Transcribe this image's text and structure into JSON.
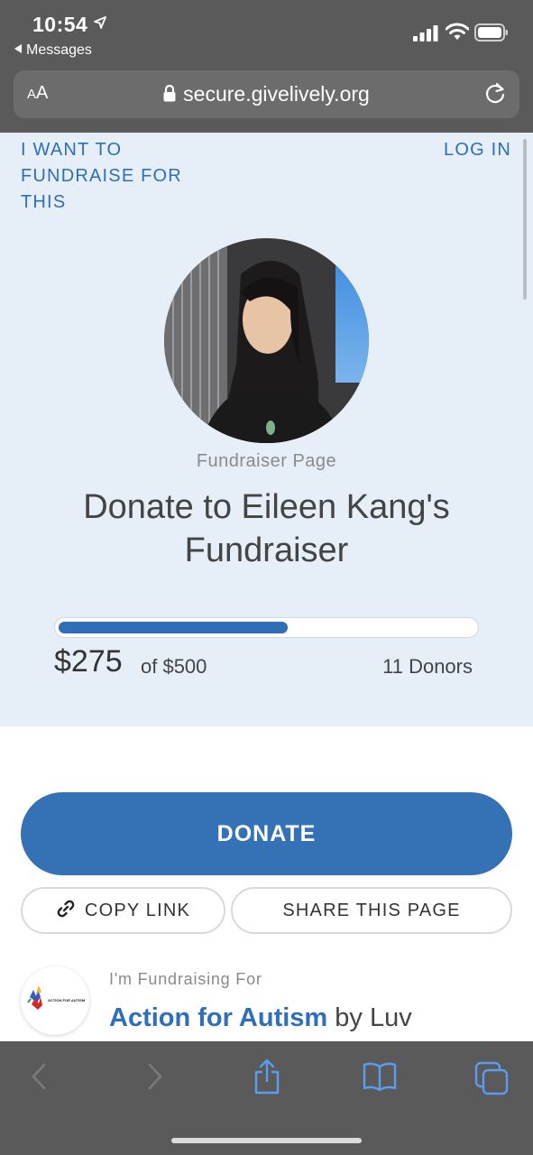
{
  "status_bar": {
    "time": "10:54",
    "back_app": "Messages"
  },
  "browser": {
    "aa_label_small": "A",
    "aa_label_large": "A",
    "url": "secure.givelively.org"
  },
  "page": {
    "fundraise_link": "I WANT TO FUNDRAISE FOR THIS",
    "login_link": "LOG IN",
    "page_label": "Fundraiser Page",
    "title": "Donate to Eileen Kang's Fundraiser",
    "progress": {
      "raised": "$275",
      "goal": "of $500",
      "fraction": 0.55,
      "donors": "11 Donors"
    },
    "donate_button": "DONATE",
    "copy_link_button": "COPY LINK",
    "share_button": "SHARE THIS PAGE",
    "fundraising_for_label": "I'm Fundraising For",
    "org_name": "Action for Autism",
    "org_by": " by Luv",
    "org_logo_text": "ACTION FOR AUTISM"
  },
  "colors": {
    "accent": "#3472b5",
    "link": "#2e6fb7",
    "hero_bg": "#e6eef8",
    "chrome": "#5a5a5a"
  },
  "icons": [
    "location-arrow-icon",
    "signal-icon",
    "wifi-icon",
    "battery-icon",
    "lock-icon",
    "reload-icon",
    "link-icon",
    "back-icon",
    "forward-icon",
    "share-icon",
    "bookmarks-icon",
    "tabs-icon"
  ]
}
